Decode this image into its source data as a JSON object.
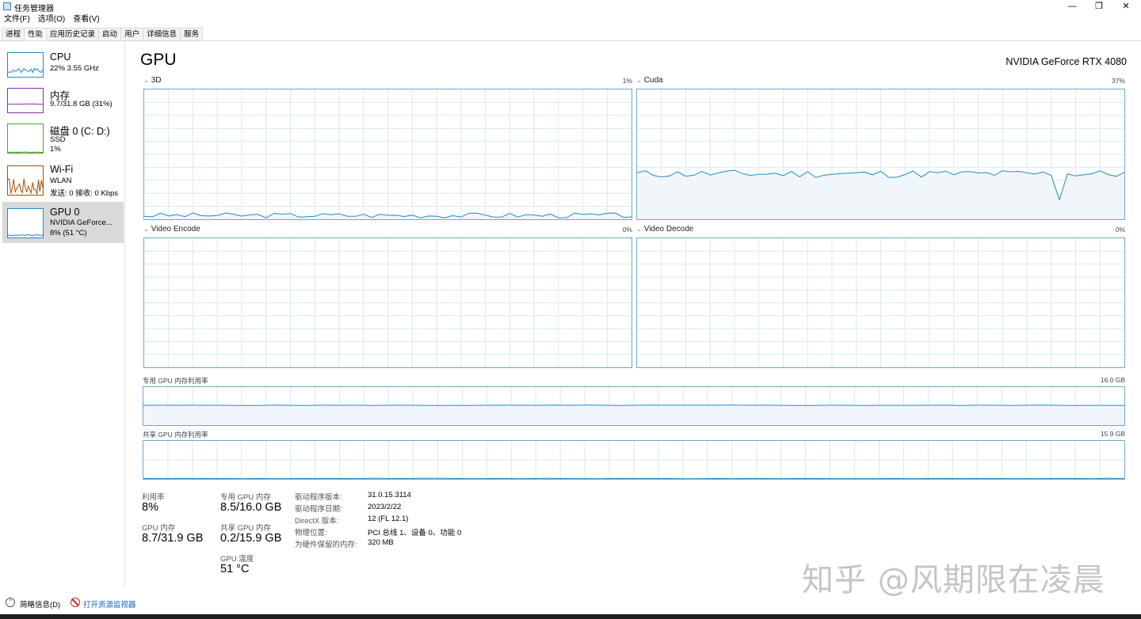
{
  "window": {
    "title": "任务管理器",
    "minimize": "—",
    "restore": "❐",
    "close": "✕"
  },
  "menu": [
    "文件(F)",
    "选项(O)",
    "查看(V)"
  ],
  "tabs": [
    "进程",
    "性能",
    "应用历史记录",
    "启动",
    "用户",
    "详细信息",
    "服务"
  ],
  "sidebar": [
    {
      "name": "CPU",
      "line1": "22% 3.55 GHz",
      "line2": "",
      "color": "#1f8bc7"
    },
    {
      "name": "内存",
      "line1": "9.7/31.8 GB (31%)",
      "line2": "",
      "color": "#9528b4"
    },
    {
      "name": "磁盘 0 (C: D:)",
      "line1": "SSD",
      "line2": "1%",
      "color": "#4ea32b"
    },
    {
      "name": "Wi-Fi",
      "line1": "WLAN",
      "line2": "发送: 0 接收: 0 Kbps",
      "color": "#a74f01"
    },
    {
      "name": "GPU 0",
      "line1": "NVIDIA GeForce...",
      "line2": "8% (51 °C)",
      "color": "#1f8bc7"
    }
  ],
  "main": {
    "title": "GPU",
    "model": "NVIDIA GeForce RTX 4080",
    "engines": [
      {
        "label": "3D",
        "pct": "1%"
      },
      {
        "label": "Cuda",
        "pct": "37%"
      },
      {
        "label": "Video Encode",
        "pct": "0%"
      },
      {
        "label": "Video Decode",
        "pct": "0%"
      }
    ],
    "dedicated_label": "专用 GPU 内存利用率",
    "dedicated_cap": "16.0 GB",
    "shared_label": "共享 GPU 内存利用率",
    "shared_cap": "15.9 GB",
    "chart_color": "#1f8bc7",
    "chart_fill": "#f1f6fa"
  },
  "stats": {
    "util_label": "利用率",
    "util_value": "8%",
    "ded_label": "专用 GPU 内存",
    "ded_value": "8.5/16.0 GB",
    "gpumem_label": "GPU 内存",
    "gpumem_value": "8.7/31.9 GB",
    "shared_label": "共享 GPU 内存",
    "shared_value": "0.2/15.9 GB",
    "temp_label": "GPU 温度",
    "temp_value": "51 °C"
  },
  "info": [
    {
      "key": "驱动程序版本:",
      "value": "31.0.15.3114"
    },
    {
      "key": "驱动程序日期:",
      "value": "2023/2/22"
    },
    {
      "key": "DirectX 版本:",
      "value": "12 (FL 12.1)"
    },
    {
      "key": "物理位置:",
      "value": "PCI 总线 1、设备 0、功能 0"
    },
    {
      "key": "为硬件保留的内存:",
      "value": "320 MB"
    }
  ],
  "footer": {
    "summary": "简略信息(D)",
    "monitor": "打开资源监视器"
  },
  "watermark": "知乎 @风期限在凌晨"
}
